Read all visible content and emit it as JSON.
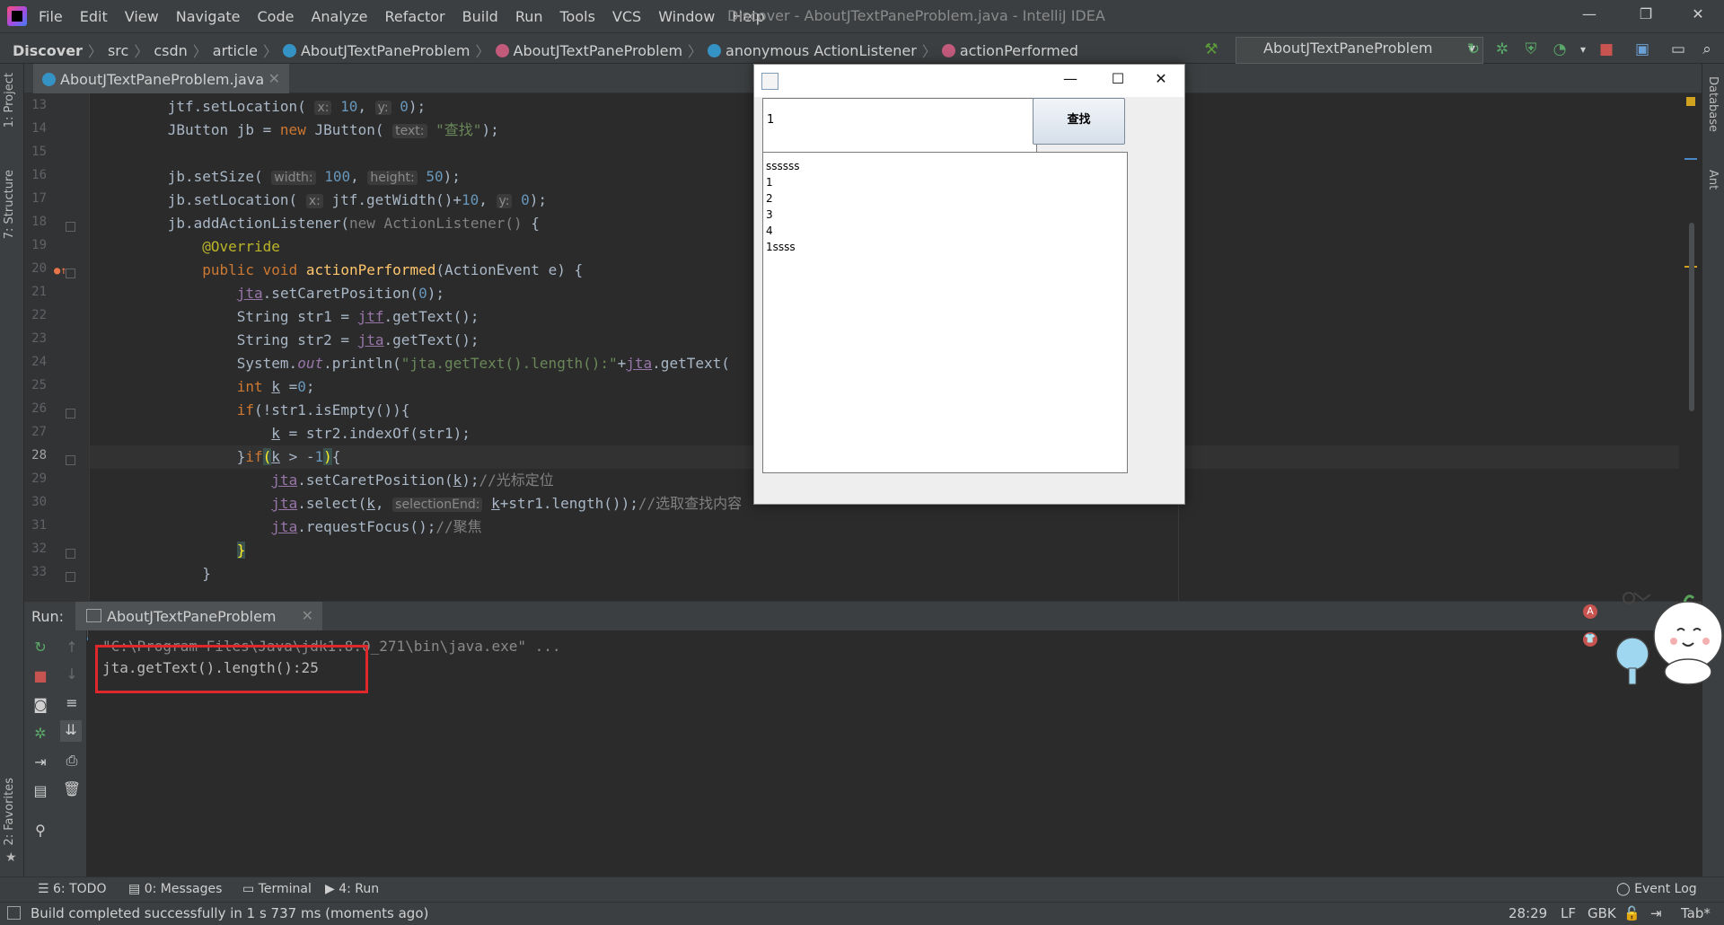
{
  "menu": [
    "File",
    "Edit",
    "View",
    "Navigate",
    "Code",
    "Analyze",
    "Refactor",
    "Build",
    "Run",
    "Tools",
    "VCS",
    "Window",
    "Help"
  ],
  "window_title": "Discover - AboutJTextPaneProblem.java - IntelliJ IDEA",
  "breadcrumb": {
    "project": "Discover",
    "items": [
      "src",
      "csdn",
      "article",
      "AboutJTextPaneProblem",
      "AboutJTextPaneProblem",
      "anonymous ActionListener",
      "actionPerformed"
    ]
  },
  "run_config": "AboutJTextPaneProblem",
  "left_tabs": [
    "1: Project",
    "7: Structure",
    "2: Favorites"
  ],
  "right_tabs": [
    "Database",
    "Ant"
  ],
  "editor": {
    "file_tab": "AboutJTextPaneProblem.java",
    "line_numbers": [
      "13",
      "14",
      "15",
      "16",
      "17",
      "18",
      "19",
      "20",
      "21",
      "22",
      "23",
      "24",
      "25",
      "26",
      "27",
      "28",
      "29",
      "30",
      "31",
      "32",
      "33"
    ],
    "current_line": "28"
  },
  "run_panel": {
    "label": "Run:",
    "tab": "AboutJTextPaneProblem",
    "cmd_line": "\"C:\\Program Files\\Java\\jdk1.8.0_271\\bin\\java.exe\" ...",
    "output": "jta.getText().length():25"
  },
  "bottom_tabs": [
    "6: TODO",
    "0: Messages",
    "Terminal",
    "4: Run"
  ],
  "event_log": "Event Log",
  "status": {
    "message": "Build completed successfully in 1 s 737 ms (moments ago)",
    "position": "28:29",
    "line_sep": "LF",
    "encoding": "GBK",
    "indent": "Tab*"
  },
  "swing_window": {
    "text_field_value": "1",
    "button_label": "查找",
    "text_area_lines": [
      "ssssss",
      "1",
      "2",
      "3",
      "4",
      "1ssss"
    ]
  },
  "colors": {
    "accent": "#4a88c7",
    "highlight_box": "#e0272b"
  }
}
